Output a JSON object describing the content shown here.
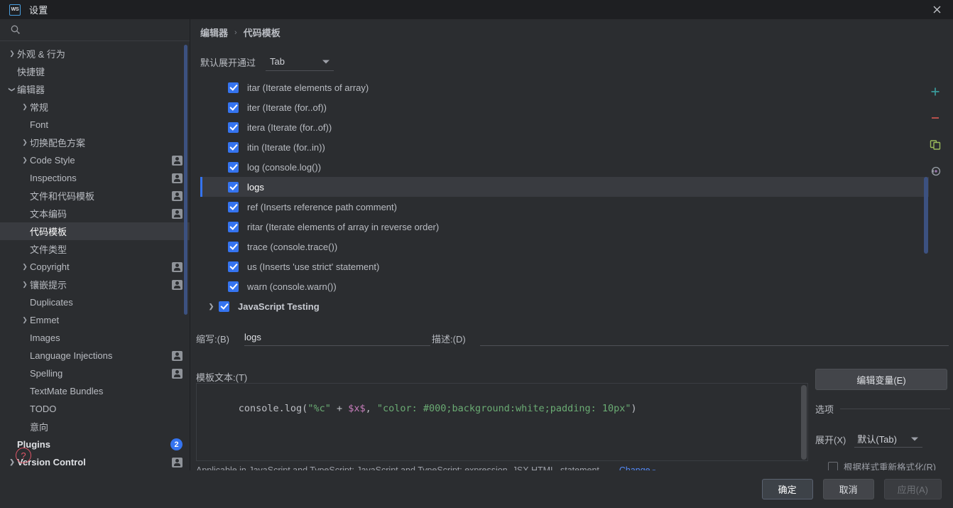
{
  "window": {
    "title": "设置",
    "app_logo": "WS",
    "close_icon": "close-icon"
  },
  "search": {
    "placeholder": "",
    "value": "",
    "icon": "search-icon"
  },
  "sidebar": {
    "items": [
      {
        "label": "外观 & 行为",
        "indent": 0,
        "chevron": "right",
        "badge": "none",
        "selected": false,
        "bold": false
      },
      {
        "label": "快捷键",
        "indent": 0,
        "chevron": "none",
        "badge": "none",
        "selected": false,
        "bold": false
      },
      {
        "label": "编辑器",
        "indent": 0,
        "chevron": "down",
        "badge": "none",
        "selected": false,
        "bold": false
      },
      {
        "label": "常规",
        "indent": 1,
        "chevron": "right",
        "badge": "none",
        "selected": false,
        "bold": false
      },
      {
        "label": "Font",
        "indent": 1,
        "chevron": "none",
        "badge": "none",
        "selected": false,
        "bold": false
      },
      {
        "label": "切换配色方案",
        "indent": 1,
        "chevron": "right",
        "badge": "none",
        "selected": false,
        "bold": false
      },
      {
        "label": "Code Style",
        "indent": 1,
        "chevron": "right",
        "badge": "user",
        "selected": false,
        "bold": false
      },
      {
        "label": "Inspections",
        "indent": 1,
        "chevron": "none",
        "badge": "user",
        "selected": false,
        "bold": false
      },
      {
        "label": "文件和代码模板",
        "indent": 1,
        "chevron": "none",
        "badge": "user",
        "selected": false,
        "bold": false
      },
      {
        "label": "文本编码",
        "indent": 1,
        "chevron": "none",
        "badge": "user",
        "selected": false,
        "bold": false
      },
      {
        "label": "代码模板",
        "indent": 1,
        "chevron": "none",
        "badge": "none",
        "selected": true,
        "bold": false
      },
      {
        "label": "文件类型",
        "indent": 1,
        "chevron": "none",
        "badge": "none",
        "selected": false,
        "bold": false
      },
      {
        "label": "Copyright",
        "indent": 1,
        "chevron": "right",
        "badge": "user",
        "selected": false,
        "bold": false
      },
      {
        "label": "镶嵌提示",
        "indent": 1,
        "chevron": "right",
        "badge": "user",
        "selected": false,
        "bold": false
      },
      {
        "label": "Duplicates",
        "indent": 1,
        "chevron": "none",
        "badge": "none",
        "selected": false,
        "bold": false
      },
      {
        "label": "Emmet",
        "indent": 1,
        "chevron": "right",
        "badge": "none",
        "selected": false,
        "bold": false
      },
      {
        "label": "Images",
        "indent": 1,
        "chevron": "none",
        "badge": "none",
        "selected": false,
        "bold": false
      },
      {
        "label": "Language Injections",
        "indent": 1,
        "chevron": "none",
        "badge": "user",
        "selected": false,
        "bold": false
      },
      {
        "label": "Spelling",
        "indent": 1,
        "chevron": "none",
        "badge": "user",
        "selected": false,
        "bold": false
      },
      {
        "label": "TextMate Bundles",
        "indent": 1,
        "chevron": "none",
        "badge": "none",
        "selected": false,
        "bold": false
      },
      {
        "label": "TODO",
        "indent": 1,
        "chevron": "none",
        "badge": "none",
        "selected": false,
        "bold": false
      },
      {
        "label": "意向",
        "indent": 1,
        "chevron": "none",
        "badge": "none",
        "selected": false,
        "bold": false
      },
      {
        "label": "Plugins",
        "indent": 0,
        "chevron": "none",
        "badge": "count",
        "badge_count": "2",
        "selected": false,
        "bold": true
      },
      {
        "label": "Version Control",
        "indent": 0,
        "chevron": "right",
        "badge": "user",
        "selected": false,
        "bold": true
      }
    ],
    "help_icon": "help-icon"
  },
  "breadcrumb": {
    "parent": "编辑器",
    "separator": "›",
    "current": "代码模板"
  },
  "expand": {
    "label": "默认展开通过",
    "value": "Tab"
  },
  "templates": [
    {
      "label": "itar (Iterate elements of array)",
      "checked": true,
      "selected": false,
      "group": false
    },
    {
      "label": "iter (Iterate (for..of))",
      "checked": true,
      "selected": false,
      "group": false
    },
    {
      "label": "itera (Iterate (for..of))",
      "checked": true,
      "selected": false,
      "group": false
    },
    {
      "label": "itin (Iterate (for..in))",
      "checked": true,
      "selected": false,
      "group": false
    },
    {
      "label": "log (console.log())",
      "checked": true,
      "selected": false,
      "group": false
    },
    {
      "label": "logs",
      "checked": true,
      "selected": true,
      "group": false
    },
    {
      "label": "ref (Inserts reference path comment)",
      "checked": true,
      "selected": false,
      "group": false
    },
    {
      "label": "ritar (Iterate elements of array in reverse order)",
      "checked": true,
      "selected": false,
      "group": false
    },
    {
      "label": "trace (console.trace())",
      "checked": true,
      "selected": false,
      "group": false
    },
    {
      "label": "us (Inserts 'use strict' statement)",
      "checked": true,
      "selected": false,
      "group": false
    },
    {
      "label": "warn (console.warn())",
      "checked": true,
      "selected": false,
      "group": false
    },
    {
      "label": "JavaScript Testing",
      "checked": true,
      "selected": false,
      "group": true
    }
  ],
  "toolbar": {
    "add": {
      "name": "add-icon",
      "glyph": "+",
      "color": "#3a9b9b"
    },
    "remove": {
      "name": "remove-icon",
      "glyph": "−",
      "color": "#c75450"
    },
    "copy": {
      "name": "copy-icon",
      "color": "#9aba5a"
    },
    "revert": {
      "name": "revert-icon",
      "color": "#9876aa"
    }
  },
  "form": {
    "abbr_label": "缩写:(B)",
    "abbr_mnemonic": "B",
    "abbr_value": "logs",
    "desc_label": "描述:(D)",
    "desc_mnemonic": "D",
    "desc_value": "",
    "template_label": "模板文本:(T)",
    "template_mnemonic": "T",
    "code_tokens": [
      {
        "text": "console.log(",
        "type": "plain"
      },
      {
        "text": "\"%c\"",
        "type": "string"
      },
      {
        "text": " + ",
        "type": "plain"
      },
      {
        "text": "$x$",
        "type": "variable"
      },
      {
        "text": ", ",
        "type": "plain"
      },
      {
        "text": "\"color: #000;background:white;padding: 10px\"",
        "type": "string"
      },
      {
        "text": ")",
        "type": "plain"
      }
    ],
    "applicable_text": "Applicable in JavaScript and TypeScript; JavaScript and TypeScript: expression, JSX HTML, statement,…",
    "change_label": "Change"
  },
  "options": {
    "edit_vars_label": "编辑变量(E)",
    "section_label": "选项",
    "expand_label": "展开(X)",
    "expand_value": "默认(Tab)",
    "reformat_label": "根据样式重新格式化(R)",
    "reformat_checked": false
  },
  "footer": {
    "ok_label": "确定",
    "cancel_label": "取消",
    "apply_label": "应用(A)"
  },
  "colors": {
    "accent": "#3574f0",
    "selection_bg": "#393b40",
    "window_bg": "#2b2d30",
    "titlebar_bg": "#1e1f22",
    "link": "#548af7",
    "string": "#6aab73",
    "variable": "#c77dbb",
    "help": "#e05567"
  }
}
